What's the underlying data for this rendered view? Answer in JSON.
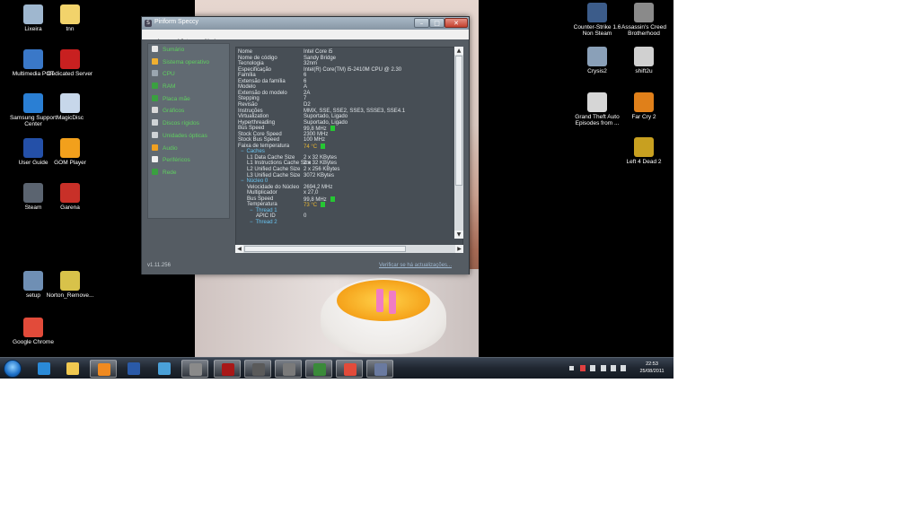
{
  "desktop": {
    "icons_left": [
      {
        "label": "Lixeira",
        "icon": "recycle-bin-icon",
        "color": "#9fb7cf"
      },
      {
        "label": "tnn",
        "icon": "folder-icon",
        "color": "#f2d36b"
      },
      {
        "label": "Multimedia POT",
        "icon": "multimedia-icon",
        "color": "#3a78c8"
      },
      {
        "label": "Dedicated Server",
        "icon": "server-icon",
        "color": "#c82020"
      },
      {
        "label": "Samsung Support Center",
        "icon": "support-icon",
        "color": "#2a7fd4"
      },
      {
        "label": "MagicDisc",
        "icon": "disc-icon",
        "color": "#c7d7ea"
      },
      {
        "label": "User Guide",
        "icon": "guide-icon",
        "color": "#2450a8"
      },
      {
        "label": "GOM Player",
        "icon": "gom-player-icon",
        "color": "#f2a01c"
      },
      {
        "label": "Steam",
        "icon": "steam-icon",
        "color": "#5b6470"
      },
      {
        "label": "Garena",
        "icon": "garena-icon",
        "color": "#c83028"
      },
      {
        "label": "setup",
        "icon": "setup-icon",
        "color": "#6f8fb4"
      },
      {
        "label": "Norton_Remove...",
        "icon": "norton-icon",
        "color": "#d8c24a"
      },
      {
        "label": "Google Chrome",
        "icon": "chrome-icon",
        "color": "#e24b3a"
      }
    ],
    "icons_right": [
      {
        "label": "Counter-Strike 1.6 Non Steam",
        "icon": "counter-strike-icon",
        "color": "#3c5c8a"
      },
      {
        "label": "Assassin's Creed Brotherhood",
        "icon": "assassins-creed-icon",
        "color": "#8a8a8a"
      },
      {
        "label": "Crysis2",
        "icon": "crysis-icon",
        "color": "#8aa0b8"
      },
      {
        "label": "shift2u",
        "icon": "shift-icon",
        "color": "#d0d0d0"
      },
      {
        "label": "Grand Theft Auto Episodes from ...",
        "icon": "gta-icon",
        "color": "#d6d6d6"
      },
      {
        "label": "Far Cry 2",
        "icon": "far-cry-icon",
        "color": "#e0801a"
      },
      {
        "label": "Left 4 Dead 2",
        "icon": "left-4-dead-icon",
        "color": "#c8a020"
      }
    ]
  },
  "window": {
    "title": "Piriform Speccy",
    "menu": [
      "arquivo",
      "Vista",
      "Ajuda"
    ],
    "sidebar": [
      {
        "label": "Sumário",
        "icon": "summary-icon",
        "color": "#e8e8e8"
      },
      {
        "label": "Sistema operativo",
        "icon": "windows-icon",
        "color": "#f0b030"
      },
      {
        "label": "CPU",
        "icon": "cpu-icon",
        "color": "#9aa6b0"
      },
      {
        "label": "RAM",
        "icon": "ram-icon",
        "color": "#3aa040"
      },
      {
        "label": "Placa mãe",
        "icon": "motherboard-icon",
        "color": "#3aa040"
      },
      {
        "label": "Gráficos",
        "icon": "graphics-icon",
        "color": "#d9d9d9"
      },
      {
        "label": "Discos rígidos",
        "icon": "hard-disk-icon",
        "color": "#cfd3d6"
      },
      {
        "label": "Unidades ópticas",
        "icon": "optical-drive-icon",
        "color": "#cfd3d6"
      },
      {
        "label": "Audio",
        "icon": "audio-icon",
        "color": "#f0a020"
      },
      {
        "label": "Periféricos",
        "icon": "peripherals-icon",
        "color": "#f0f0f0"
      },
      {
        "label": "Rede",
        "icon": "network-icon",
        "color": "#3aa040"
      }
    ],
    "details": [
      {
        "key": "Nome",
        "value": "Intel Core i5",
        "indent": 0
      },
      {
        "key": "Nome de código",
        "value": "Sandy Bridge",
        "indent": 0
      },
      {
        "key": "Tecnologia",
        "value": "32nm",
        "indent": 0
      },
      {
        "key": "Especificação",
        "value": "Intel(R) Core(TM) i5-2410M CPU @ 2.30",
        "indent": 0
      },
      {
        "key": "Família",
        "value": "6",
        "indent": 0
      },
      {
        "key": "Extensão da família",
        "value": "6",
        "indent": 0
      },
      {
        "key": "Modelo",
        "value": "A",
        "indent": 0
      },
      {
        "key": "Extensão do modelo",
        "value": "2A",
        "indent": 0
      },
      {
        "key": "Stepping",
        "value": "7",
        "indent": 0
      },
      {
        "key": "Revisão",
        "value": "D2",
        "indent": 0
      },
      {
        "key": "Instruções",
        "value": "MMX, SSE, SSE2, SSE3, SSSE3, SSE4.1",
        "indent": 0
      },
      {
        "key": "Virtualization",
        "value": "Suportado, Ligado",
        "indent": 0
      },
      {
        "key": "Hyperthreading",
        "value": "Suportado, Ligado",
        "indent": 0
      },
      {
        "key": "Bus Speed",
        "value": "99,8 MHz",
        "indent": 0,
        "indicator": true
      },
      {
        "key": "Stock Core Speed",
        "value": "2300 MHz",
        "indent": 0
      },
      {
        "key": "Stock Bus Speed",
        "value": "100 MHz",
        "indent": 0
      },
      {
        "key": "Faixa de temperatura",
        "value": "74 °C",
        "indent": 0,
        "warm": true,
        "indicator": true
      },
      {
        "key": "Caches",
        "value": "",
        "indent": 1,
        "header": true,
        "prefix": "−"
      },
      {
        "key": "L1 Data Cache Size",
        "value": "2 x 32 KBytes",
        "indent": 2
      },
      {
        "key": "L1 Instructions Cache Size",
        "value": "2 x 32 KBytes",
        "indent": 2
      },
      {
        "key": "L2 Unified Cache Size",
        "value": "2 x 256 KBytes",
        "indent": 2
      },
      {
        "key": "L3 Unified Cache Size",
        "value": "3072 KBytes",
        "indent": 2
      },
      {
        "key": "Núcleo 0",
        "value": "",
        "indent": 1,
        "header": true,
        "prefix": "−"
      },
      {
        "key": "Velocidade do Núcleo",
        "value": "2694,2 MHz",
        "indent": 2
      },
      {
        "key": "Multiplicador",
        "value": "x 27,0",
        "indent": 2
      },
      {
        "key": "Bus Speed",
        "value": "99,8 MHz",
        "indent": 2,
        "indicator": true
      },
      {
        "key": "Temperatura",
        "value": "73 °C",
        "indent": 2,
        "warm": true,
        "indicator": true
      },
      {
        "key": "Thread 1",
        "value": "",
        "indent": 3,
        "header": true,
        "prefix": "−"
      },
      {
        "key": "APIC ID",
        "value": "0",
        "indent": 4
      },
      {
        "key": "Thread 2",
        "value": "",
        "indent": 3,
        "header": true,
        "prefix": "−"
      }
    ],
    "version": "v1.11.256",
    "update_link": "Verificar se há actualizações..."
  },
  "taskbar": {
    "pinned": [
      {
        "icon": "internet-explorer-icon",
        "color": "#2a8ad8"
      },
      {
        "icon": "explorer-icon",
        "color": "#f0c850"
      },
      {
        "icon": "media-player-icon",
        "color": "#f08a20",
        "active": true
      },
      {
        "icon": "word-icon",
        "color": "#2a5aa8"
      },
      {
        "icon": "messenger-icon",
        "color": "#4aa0d8"
      },
      {
        "icon": "steam-task-icon",
        "color": "#8a8a8a",
        "active": true
      },
      {
        "icon": "dedicated-server-task-icon",
        "color": "#a81818",
        "active": true
      },
      {
        "icon": "assassins-task-icon",
        "color": "#5a5a5a",
        "active": true
      },
      {
        "icon": "game-task-icon",
        "color": "#7a7a7a",
        "active": true
      },
      {
        "icon": "image-viewer-task-icon",
        "color": "#3a8a3a",
        "active": true
      },
      {
        "icon": "chrome-task-icon",
        "color": "#e24b3a",
        "active": true
      },
      {
        "icon": "speccy-task-icon",
        "color": "#6a7aa0",
        "active": true
      }
    ],
    "clock_time": "22:53",
    "clock_date": "25/08/2011"
  }
}
